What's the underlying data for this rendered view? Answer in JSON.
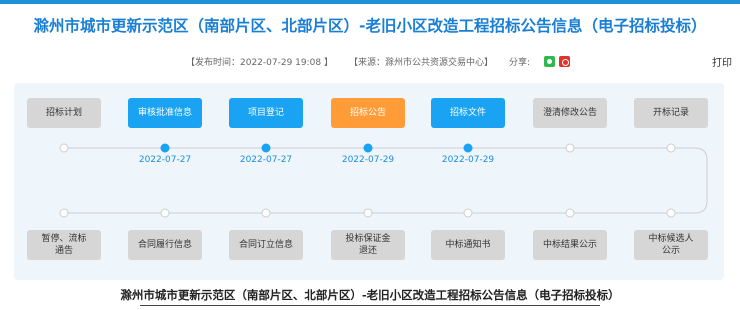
{
  "title": "滁州市城市更新示范区（南部片区、北部片区）-老旧小区改造工程招标公告信息（电子招标投标）",
  "meta": {
    "publish_time": "【发布时间：2022-07-29 19:08 】",
    "source": "【来源：滁州市公共资源交易中心】",
    "share_label": "分享:",
    "share_icons": [
      "wechat-icon",
      "weibo-icon"
    ],
    "print_label": "打印"
  },
  "colors": {
    "accent": "#1a7fd4",
    "active_stage": "#1aa3f2",
    "current_stage": "#ff9c38",
    "inactive_stage": "#d6d6d6"
  },
  "top_stages": [
    {
      "label": "招标计划",
      "state": "inactive",
      "date": ""
    },
    {
      "label": "审核批准信息",
      "state": "active",
      "date": "2022-07-27"
    },
    {
      "label": "项目登记",
      "state": "active",
      "date": "2022-07-27"
    },
    {
      "label": "招标公告",
      "state": "current",
      "date": "2022-07-29"
    },
    {
      "label": "招标文件",
      "state": "active",
      "date": "2022-07-29"
    },
    {
      "label": "澄清修改公告",
      "state": "inactive",
      "date": ""
    },
    {
      "label": "开标记录",
      "state": "inactive",
      "date": ""
    }
  ],
  "bottom_stages": [
    {
      "label": "暂停、流标\n通告",
      "state": "inactive"
    },
    {
      "label": "合同履行信息",
      "state": "inactive"
    },
    {
      "label": "合同订立信息",
      "state": "inactive"
    },
    {
      "label": "投标保证金\n退还",
      "state": "inactive"
    },
    {
      "label": "中标通知书",
      "state": "inactive"
    },
    {
      "label": "中标结果公示",
      "state": "inactive"
    },
    {
      "label": "中标候选人\n公示",
      "state": "inactive"
    }
  ],
  "doc_heading": "滁州市城市更新示范区（南部片区、北部片区）-老旧小区改造工程招标公告信息（电子招标投标）"
}
